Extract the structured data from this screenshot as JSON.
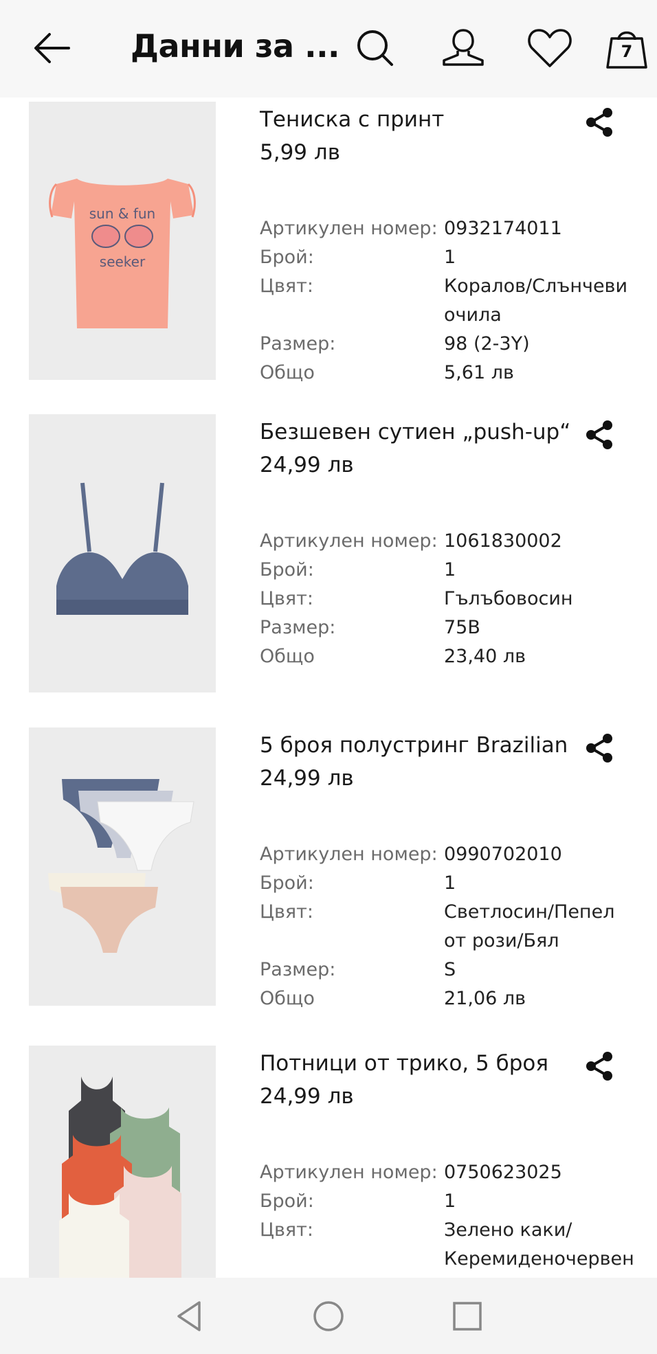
{
  "header": {
    "title": "Данни за ...",
    "bag_count": "7"
  },
  "items": [
    {
      "name": "Тениска с принт",
      "price": "5,99 лв",
      "article_label": "Артикулен номер:",
      "article": "0932174011",
      "qty_label": "Брой:",
      "qty": "1",
      "color_label": "Цвят:",
      "color": "Коралов/Слънчеви очила",
      "size_label": "Размер:",
      "size": "98 (2-3Y)",
      "total_label": "Общо",
      "total": "5,61 лв"
    },
    {
      "name": "Безшевен сутиен „push-up“",
      "price": "24,99 лв",
      "article_label": "Артикулен номер:",
      "article": "1061830002",
      "qty_label": "Брой:",
      "qty": "1",
      "color_label": "Цвят:",
      "color": "Гълъбовосин",
      "size_label": "Размер:",
      "size": "75B",
      "total_label": "Общо",
      "total": "23,40 лв"
    },
    {
      "name": "5 броя полустринг Brazilian",
      "price": "24,99 лв",
      "article_label": "Артикулен номер:",
      "article": "0990702010",
      "qty_label": "Брой:",
      "qty": "1",
      "color_label": "Цвят:",
      "color": "Светлосин/Пепел от рози/Бял",
      "size_label": "Размер:",
      "size": "S",
      "total_label": "Общо",
      "total": "21,06 лв"
    },
    {
      "name": "Потници от трико, 5 броя",
      "price": "24,99 лв",
      "article_label": "Артикулен номер:",
      "article": "0750623025",
      "qty_label": "Брой:",
      "qty": "1",
      "color_label": "Цвят:",
      "color": "Зелено каки/Керемиденочервен"
    }
  ],
  "icons": {
    "back": "back-arrow-icon",
    "search": "search-icon",
    "account": "account-icon",
    "favorites": "heart-icon",
    "bag": "shopping-bag-icon",
    "share": "share-icon",
    "nav_back": "nav-back-icon",
    "nav_home": "nav-home-icon",
    "nav_recents": "nav-recents-icon"
  },
  "colors": {
    "header_bg": "#f7f7f7",
    "label_gray": "#6b6b6b",
    "text": "#222222"
  }
}
